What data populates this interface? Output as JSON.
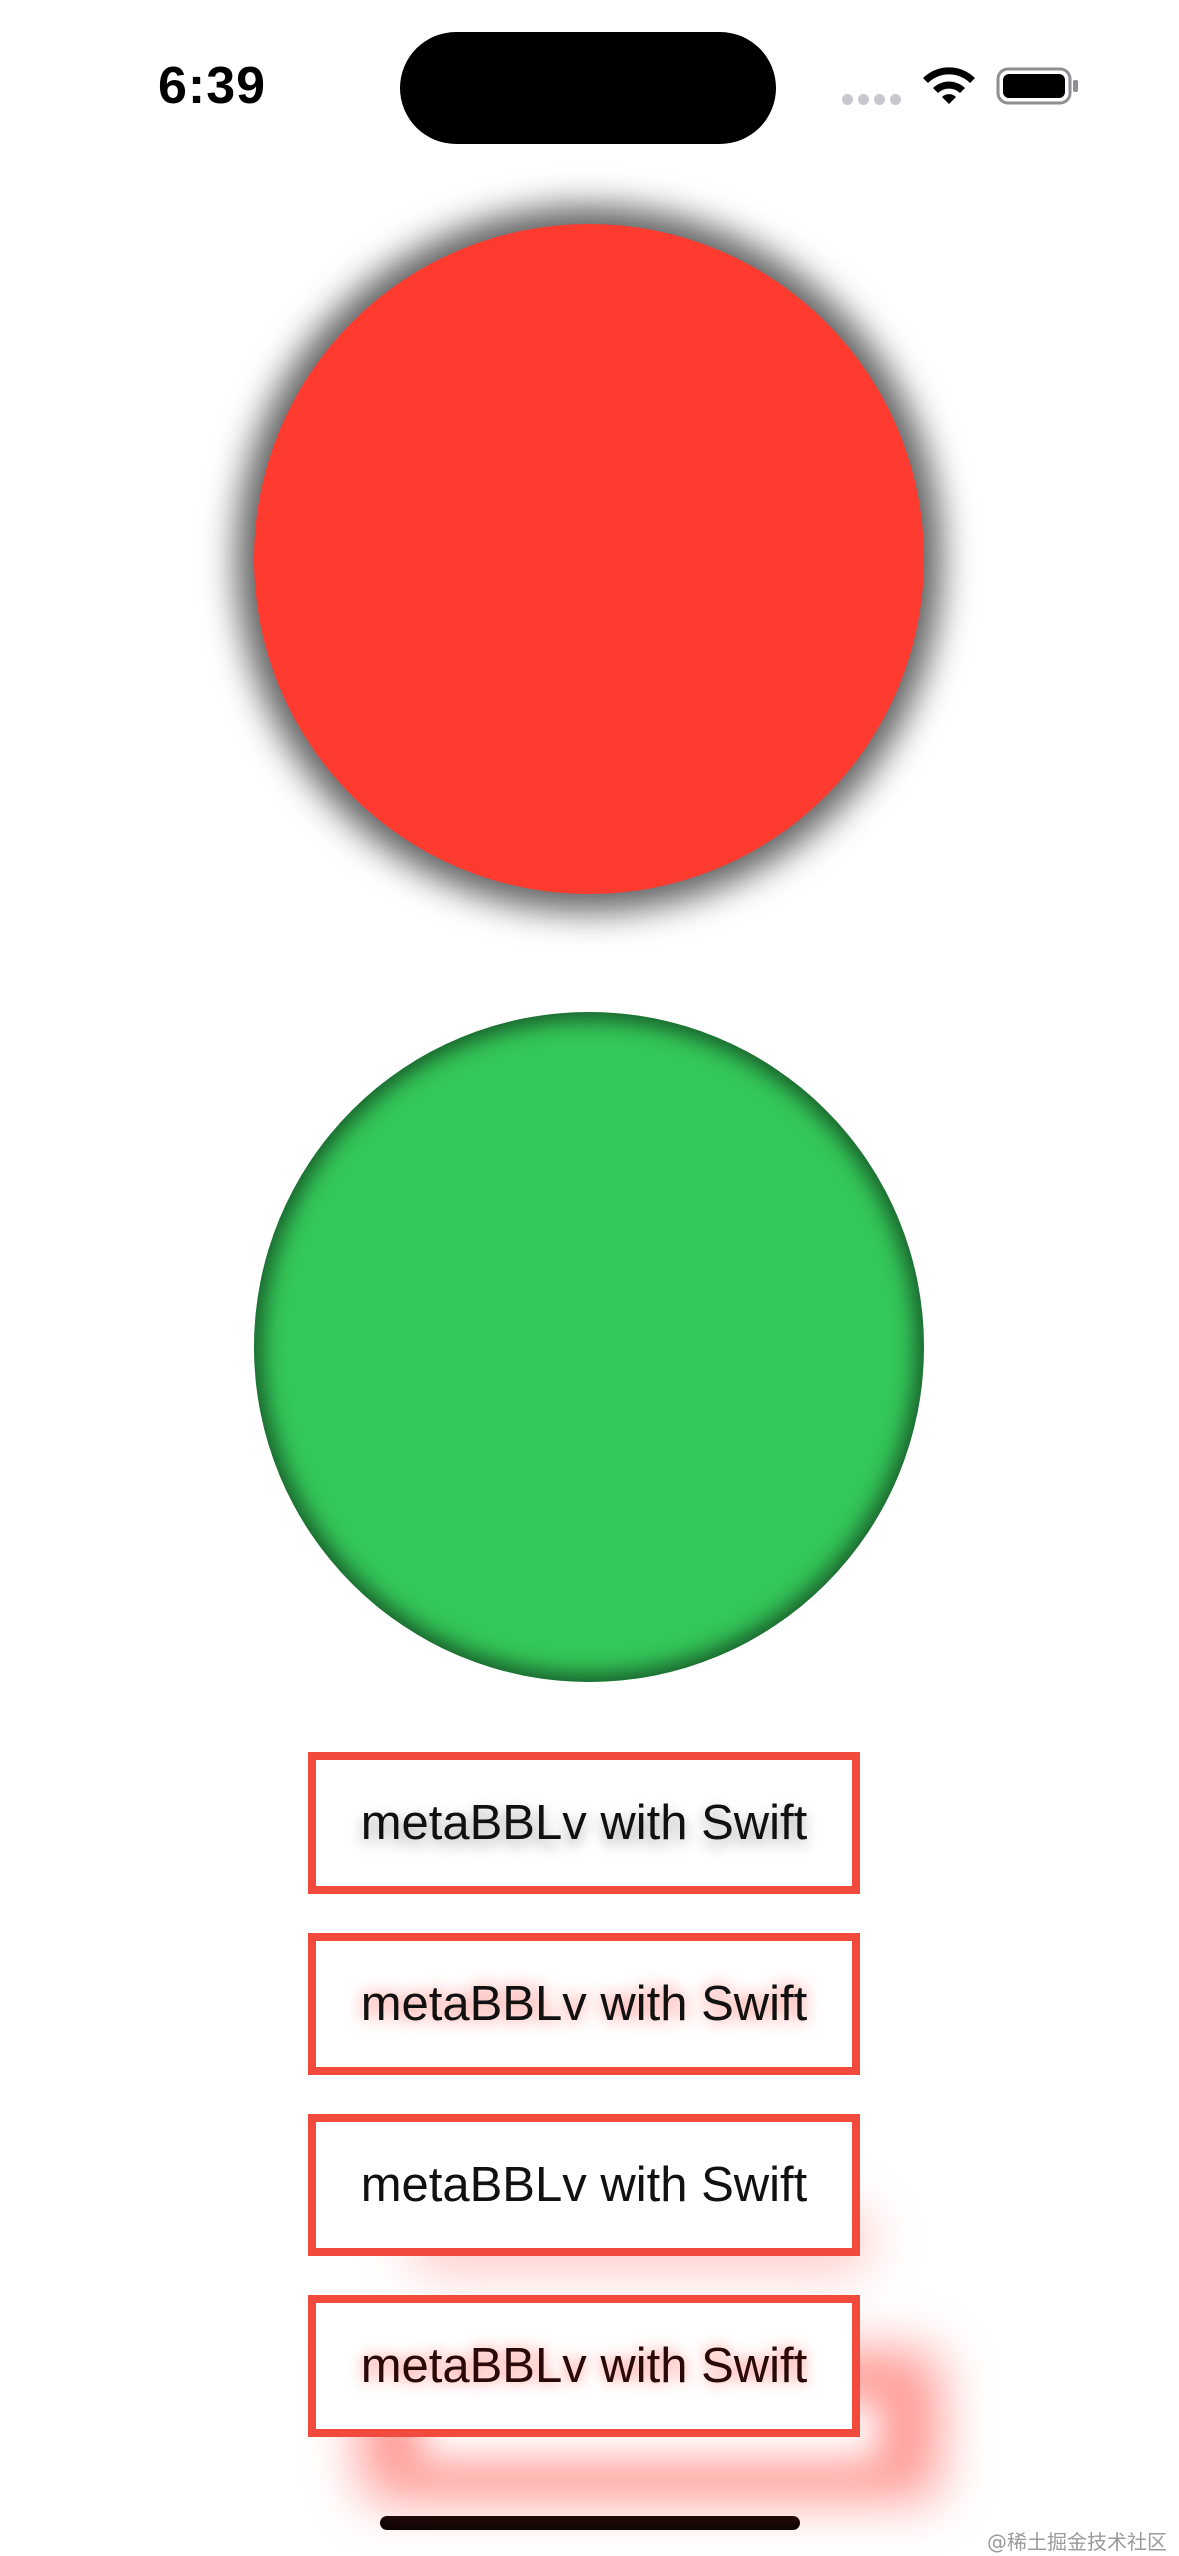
{
  "status_bar": {
    "time": "6:39",
    "icons": [
      "cellular-dots-icon",
      "wifi-icon",
      "battery-icon"
    ]
  },
  "circles": [
    {
      "name": "red-circle",
      "color": "#ff3b30",
      "effect": "outer shadow"
    },
    {
      "name": "green-circle",
      "color": "#34c759",
      "effect": "inner shadow"
    }
  ],
  "labels": [
    {
      "text": "metaBBLv with Swift"
    },
    {
      "text": "metaBBLv with Swift"
    },
    {
      "text": "metaBBLv with Swift"
    },
    {
      "text": "metaBBLv with Swift"
    }
  ],
  "colors": {
    "box_border": "#f24a3d",
    "background": "#ffffff"
  },
  "watermark": "@稀土掘金技术社区"
}
